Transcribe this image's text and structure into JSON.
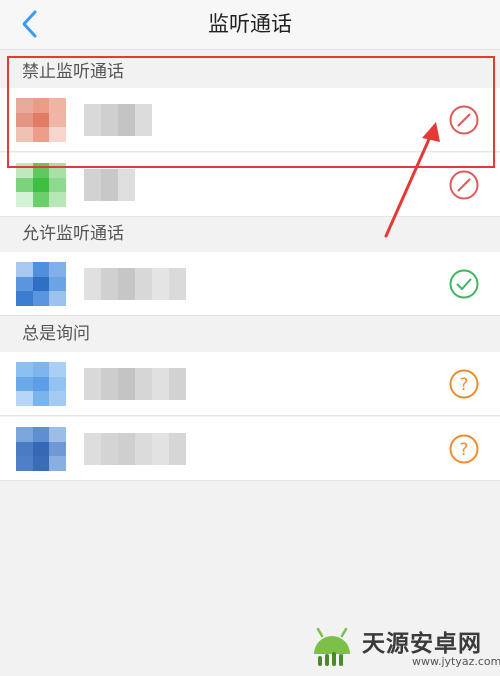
{
  "header": {
    "title": "监听通话"
  },
  "sections": [
    {
      "label": "禁止监听通话",
      "status": "blocked",
      "rows": [
        {
          "avatar_colors": [
            "#e8a89a",
            "#ec9c86",
            "#f1b3a4",
            "#e49684",
            "#e07c66",
            "#efb6a8",
            "#f0c2b6",
            "#ec9e8c",
            "#f6d6cc"
          ],
          "name_blocks": [
            "#d9d9d9",
            "#cfcfcf",
            "#c4c4c4",
            "#dcdcdc"
          ]
        },
        {
          "avatar_colors": [
            "#bfe8bf",
            "#5fc85f",
            "#a8e0a8",
            "#7bd47b",
            "#3fbf3f",
            "#8fd88f",
            "#d6f2d6",
            "#6ccf6c",
            "#b7e6b7"
          ],
          "name_blocks": [
            "#d2d2d2",
            "#c8c8c8",
            "#dedede"
          ]
        }
      ]
    },
    {
      "label": "允许监听通话",
      "status": "allowed",
      "rows": [
        {
          "avatar_colors": [
            "#a8c8ef",
            "#4f8fdc",
            "#7fb0e8",
            "#5a95de",
            "#2f6fc4",
            "#6aa4e4",
            "#3c7cd0",
            "#5b95df",
            "#9ec2ee"
          ],
          "name_blocks": [
            "#e0e0e0",
            "#d0d0d0",
            "#c6c6c6",
            "#d8d8d8",
            "#e4e4e4",
            "#dadada"
          ]
        }
      ]
    },
    {
      "label": "总是询问",
      "status": "ask",
      "rows": [
        {
          "avatar_colors": [
            "#8cc0f0",
            "#7db6ee",
            "#a9cff4",
            "#6aa9ea",
            "#5c9fe6",
            "#93c3f1",
            "#b5d6f6",
            "#7ab4ec",
            "#a2caf3"
          ],
          "name_blocks": [
            "#d9d9d9",
            "#cdcdcd",
            "#c4c4c4",
            "#d6d6d6",
            "#e0e0e0",
            "#d2d2d2"
          ]
        },
        {
          "avatar_colors": [
            "#7aa6dc",
            "#5d8fd2",
            "#9cbde6",
            "#4a7cc4",
            "#3568b5",
            "#6e99d6",
            "#4f7fc6",
            "#3b6cb8",
            "#88afe0"
          ],
          "name_blocks": [
            "#dddddd",
            "#d4d4d4",
            "#cfcfcf",
            "#dbdbdb",
            "#e2e2e2",
            "#d6d6d6"
          ]
        }
      ]
    }
  ],
  "colors": {
    "blocked": "#e05a5a",
    "allowed": "#3fb55f",
    "ask": "#f08c2e",
    "back": "#3a9bf0",
    "highlight": "#e53935"
  },
  "icons": {
    "blocked": "no-entry-icon",
    "allowed": "check-circle-icon",
    "ask": "question-circle-icon",
    "back": "chevron-left-icon"
  },
  "watermark": {
    "text": "天源安卓网",
    "url": "www.jytyaz.com"
  }
}
